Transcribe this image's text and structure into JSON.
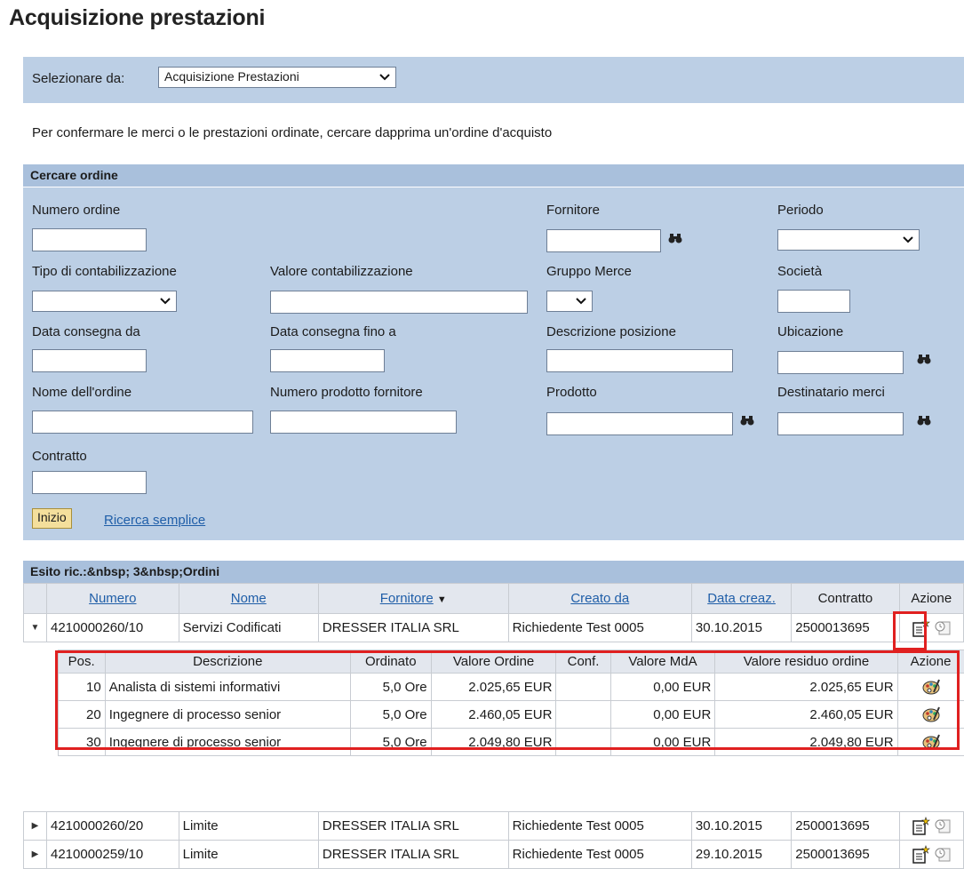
{
  "page_title": "Acquisizione prestazioni",
  "select_bar": {
    "label": "Selezionare da:",
    "selected": "Acquisizione Prestazioni"
  },
  "info_text": "Per confermare le merci o le prestazioni ordinate, cercare dapprima un'ordine d'acquisto",
  "search": {
    "header": "Cercare ordine",
    "fields": {
      "numero_ordine": "Numero ordine",
      "fornitore": "Fornitore",
      "periodo": "Periodo",
      "tipo_contab": "Tipo di contabilizzazione",
      "valore_contab": "Valore contabilizzazione",
      "gruppo_merce": "Gruppo Merce",
      "societa": "Società",
      "data_da": "Data consegna da",
      "data_fino": "Data consegna fino a",
      "descr_pos": "Descrizione posizione",
      "ubicazione": "Ubicazione",
      "nome_ordine": "Nome dell'ordine",
      "num_prod_forn": "Numero prodotto fornitore",
      "prodotto": "Prodotto",
      "destinatario": "Destinatario merci",
      "contratto": "Contratto"
    },
    "start_button": "Inizio",
    "simple_search_link": "Ricerca semplice"
  },
  "results": {
    "header": "Esito ric.:&nbsp; 3&nbsp;Ordini",
    "columns": [
      "Numero",
      "Nome",
      "Fornitore",
      "Creato da",
      "Data creaz.",
      "Contratto",
      "Azione"
    ],
    "rows": [
      {
        "numero": "4210000260/10",
        "nome": "Servizi Codificati",
        "fornitore": "DRESSER ITALIA SRL",
        "creato_da": "Richiedente Test 0005",
        "data": "30.10.2015",
        "contratto": "2500013695"
      },
      {
        "numero": "4210000260/20",
        "nome": "Limite",
        "fornitore": "DRESSER ITALIA SRL",
        "creato_da": "Richiedente Test 0005",
        "data": "30.10.2015",
        "contratto": "2500013695"
      },
      {
        "numero": "4210000259/10",
        "nome": "Limite",
        "fornitore": "DRESSER ITALIA SRL",
        "creato_da": "Richiedente Test 0005",
        "data": "29.10.2015",
        "contratto": "2500013695"
      }
    ],
    "positions": {
      "columns": [
        "Pos.",
        "Descrizione",
        "Ordinato",
        "Valore Ordine",
        "Conf.",
        "Valore MdA",
        "Valore residuo ordine",
        "Azione"
      ],
      "rows": [
        {
          "pos": "10",
          "descr": "Analista di sistemi informativi",
          "ordinato": "5,0 Ore",
          "valore": "2.025,65 EUR",
          "conf": "",
          "mda": "0,00 EUR",
          "residuo": "2.025,65 EUR"
        },
        {
          "pos": "20",
          "descr": "Ingegnere di processo senior",
          "ordinato": "5,0 Ore",
          "valore": "2.460,05 EUR",
          "conf": "",
          "mda": "0,00 EUR",
          "residuo": "2.460,05 EUR"
        },
        {
          "pos": "30",
          "descr": "Ingegnere di processo senior",
          "ordinato": "5,0 Ore",
          "valore": "2.049,80 EUR",
          "conf": "",
          "mda": "0,00 EUR",
          "residuo": "2.049,80 EUR"
        }
      ]
    }
  },
  "colors": {
    "panel": "#bccfe5",
    "header": "#a9c0dc",
    "link": "#1f5ea8",
    "highlight": "#e02020",
    "button": "#f4df9c"
  }
}
